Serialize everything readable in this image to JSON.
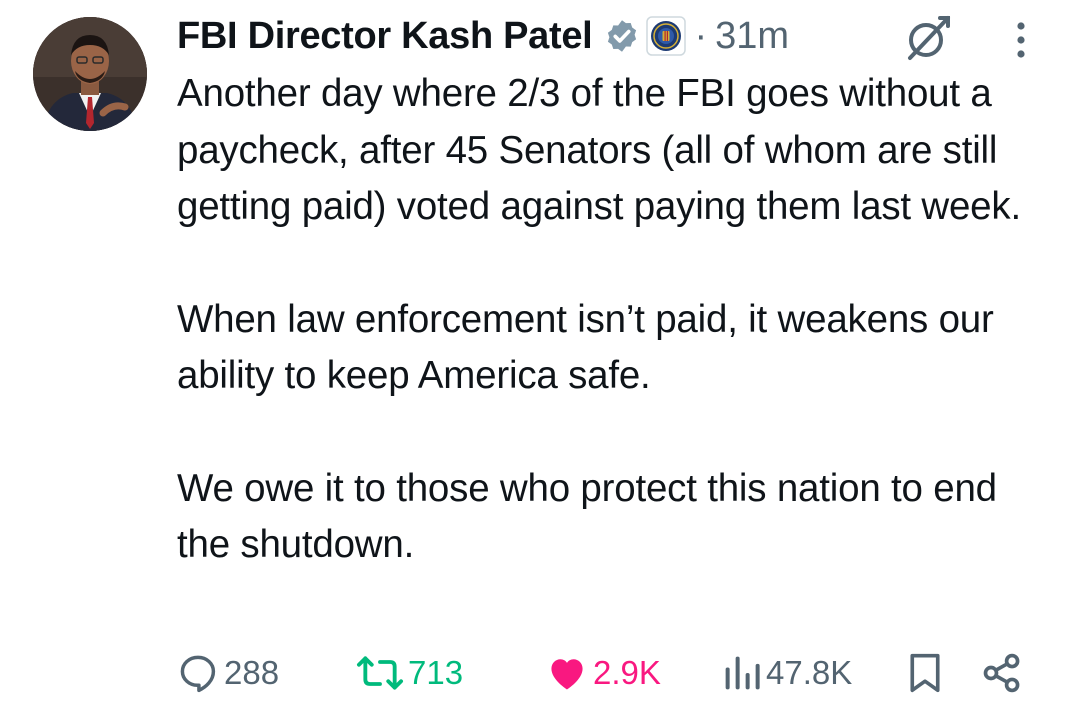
{
  "author": {
    "display_name": "FBI Director Kash Patel",
    "verified_icon": "verified-badge-icon",
    "affiliation_icon": "fbi-seal-icon",
    "separator": "·",
    "timestamp": "31m"
  },
  "tweet": {
    "paragraphs": [
      "Another day where 2/3 of the FBI goes without a paycheck, after 45 Senators (all of whom are still getting paid) voted against paying them last week.",
      "When law enforcement isn’t paid, it weakens our ability to keep America safe.",
      "We owe it to those who protect this nation to end the shutdown."
    ]
  },
  "actions": {
    "reply_count": "288",
    "repost_count": "713",
    "like_count": "2.9K",
    "view_count": "47.8K"
  },
  "colors": {
    "text": "#0f1419",
    "secondary": "#536471",
    "repost": "#00ba7c",
    "like": "#f91880",
    "verified": "#829aab"
  }
}
